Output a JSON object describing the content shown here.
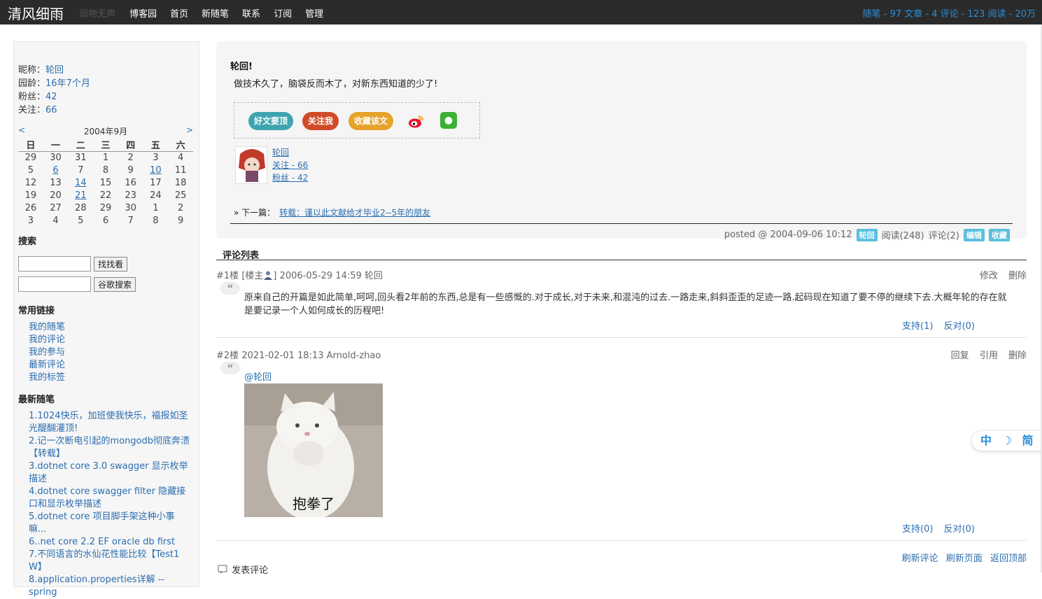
{
  "header": {
    "title": "清风细雨",
    "subtitle": "润物无声",
    "nav": [
      "博客园",
      "首页",
      "新随笔",
      "联系",
      "订阅",
      "管理"
    ],
    "stats": "随笔 - 97  文章 - 4  评论 - 123  阅读 - 20万"
  },
  "sidebar": {
    "profile": [
      {
        "label": "昵称：",
        "value": "轮回"
      },
      {
        "label": "园龄：",
        "value": "16年7个月"
      },
      {
        "label": "粉丝：",
        "value": "42"
      },
      {
        "label": "关注：",
        "value": "66"
      }
    ],
    "calendar": {
      "prev": "<",
      "month": "2004年9月",
      "next": ">",
      "weekdays": [
        "日",
        "一",
        "二",
        "三",
        "四",
        "五",
        "六"
      ],
      "weeks": [
        [
          "29",
          "30",
          "31",
          "1",
          "2",
          "3",
          "4"
        ],
        [
          "5",
          "6",
          "7",
          "8",
          "9",
          "10",
          "11"
        ],
        [
          "12",
          "13",
          "14",
          "15",
          "16",
          "17",
          "18"
        ],
        [
          "19",
          "20",
          "21",
          "22",
          "23",
          "24",
          "25"
        ],
        [
          "26",
          "27",
          "28",
          "29",
          "30",
          "1",
          "2"
        ],
        [
          "3",
          "4",
          "5",
          "6",
          "7",
          "8",
          "9"
        ]
      ],
      "linked_days": [
        "6",
        "10",
        "14",
        "21"
      ]
    },
    "search": {
      "title": "搜索",
      "button1": "找找看",
      "button2": "谷歌搜索"
    },
    "links": {
      "title": "常用链接",
      "items": [
        "我的随笔",
        "我的评论",
        "我的参与",
        "最新评论",
        "我的标签"
      ]
    },
    "recent": {
      "title": "最新随笔",
      "items": [
        "1.1024快乐，加班使我快乐，福报如圣光醍醐灌顶!",
        "2.记一次断电引起的mongodb彻底奔溃【转载】",
        "3.dotnet core 3.0 swagger 显示枚举描述",
        "4.dotnet core swagger filter 隐藏接口和显示枚举描述",
        "5.dotnet core 项目脚手架这种小事嘛...",
        "6..net core 2.2 EF oracle db first",
        "7.不同语言的水仙花性能比较【Test1 W】",
        "8.application.properties详解 --spring"
      ]
    }
  },
  "post": {
    "title": "轮回!",
    "body": "做技术久了，脑袋反而木了，对新东西知道的少了!",
    "share_buttons": [
      "好文要顶",
      "关注我",
      "收藏该文"
    ],
    "author": {
      "name": "轮回",
      "following": "关注 - 66",
      "followers": "粉丝 - 42"
    },
    "next_label": "» 下一篇：",
    "next_link": "转载：谨以此文献给才毕业2--5年的朋友",
    "footer": {
      "posted": "posted @ 2004-09-06 10:12",
      "author_tag": "轮回",
      "reads": "阅读(248)",
      "comments": "评论(2)",
      "edit": "编辑",
      "fav": "收藏"
    }
  },
  "comments": {
    "title": "评论列表",
    "items": [
      {
        "floor": "#1楼",
        "owner_tag": "[楼主",
        "owner_tag_end": "]",
        "date": "2006-05-29 14:59",
        "author": "轮回",
        "actions": [
          "修改",
          "删除"
        ],
        "body": "原来自己的开篇是如此简单,呵呵,回头看2年前的东西,总是有一些感慨的.对于成长,对于未来,和混沌的过去.一路走来,斜斜歪歪的足迹一路.起码现在知道了要不停的继续下去.大概年轮的存在就是要记录一个人如何成长的历程吧!",
        "support": "支持(1)",
        "oppose": "反对(0)"
      },
      {
        "floor": "#2楼",
        "date": "2021-02-01 18:13",
        "author": "Arnold-zhao",
        "actions": [
          "回复",
          "引用",
          "删除"
        ],
        "mention": "@轮回",
        "meme_caption": "抱拳了",
        "support": "支持(0)",
        "oppose": "反对(0)"
      }
    ],
    "bottom_links": [
      "刷新评论",
      "刷新页面",
      "返回顶部"
    ],
    "post_comment": "发表评论"
  },
  "float_toolbar": [
    "中",
    "简"
  ],
  "colors": {
    "topbar": "#2b2b2b",
    "link": "#2a6db0",
    "stats": "#2a8fd8",
    "tag": "#5bc0de"
  }
}
